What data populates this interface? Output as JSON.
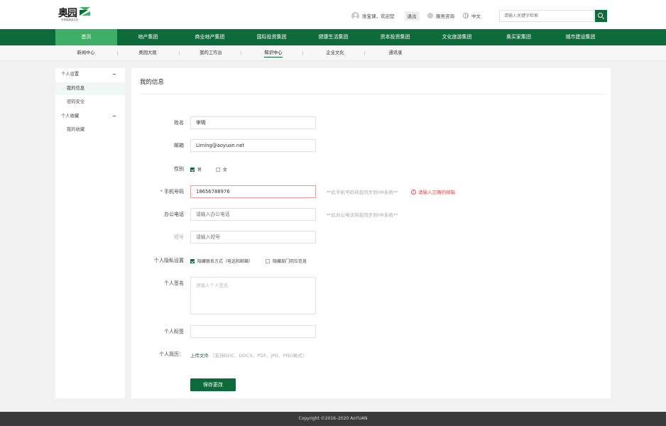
{
  "header": {
    "logo_text": "奥园",
    "logo_sub": "华侨城旅游文化",
    "username": "张宝课，欢迎您",
    "logout_label": "退出",
    "service_label": "服务咨询",
    "lang_label": "中文",
    "search_placeholder": "请输入关键字检索"
  },
  "main_nav": [
    {
      "label": "首页",
      "active": true
    },
    {
      "label": "地产集团"
    },
    {
      "label": "商业地产集团"
    },
    {
      "label": "国际投资集团"
    },
    {
      "label": "健康生活集团"
    },
    {
      "label": "资本投资集团"
    },
    {
      "label": "文化旅游集团"
    },
    {
      "label": "奥买家集团"
    },
    {
      "label": "城市建设集团"
    }
  ],
  "sub_nav": [
    {
      "label": "新闻中心"
    },
    {
      "label": "奥园大观"
    },
    {
      "label": "我的工作台"
    },
    {
      "label": "知识中心",
      "active": true
    },
    {
      "label": "企业文化"
    },
    {
      "label": "通讯录"
    }
  ],
  "sidebar": {
    "groups": [
      {
        "label": "个人设置",
        "items": [
          {
            "label": "我的信息",
            "active": true
          },
          {
            "label": "密码安全"
          }
        ]
      },
      {
        "label": "个人收藏",
        "items": [
          {
            "label": "我的收藏"
          }
        ]
      }
    ]
  },
  "content": {
    "title": "我的信息",
    "name_label": "姓名",
    "name_value": "李明",
    "email_label": "邮箱",
    "email_value": "Liming@aoyuan.net",
    "gender_label": "性别",
    "gender_male": "男",
    "gender_female": "女",
    "phone_label": "手机号码",
    "phone_required": "*",
    "phone_value": "18656788976",
    "phone_hint": "**此手机号码将会同步到HR系统**",
    "phone_error": "请输入正确的邮箱",
    "office_label": "办公电话",
    "office_placeholder": "请输入办公电话",
    "office_hint": "**此办公电话将会同步到HR系统**",
    "short_label": "短号",
    "short_placeholder": "请输入短号",
    "privacy_label": "个人隐私设置",
    "privacy_opt1": "隐藏联系方式（电话和邮箱）",
    "privacy_opt2": "隐藏部门岗位信息",
    "signature_label": "个人签名",
    "signature_placeholder": "请输入个人签名",
    "tags_label": "个人标签",
    "resume_label": "个人简历：",
    "upload_label": "上传文件",
    "upload_hint": "（支持DOC、DOCX、PDF、JPG、PNG格式）",
    "save_label": "保存更改"
  },
  "footer": {
    "copyright": "Copyright ©2016–2020 AoYUAN"
  },
  "colors": {
    "brand_green": "#0d6b3b",
    "active_green": "#3fae68",
    "error_red": "#e04a4a"
  }
}
